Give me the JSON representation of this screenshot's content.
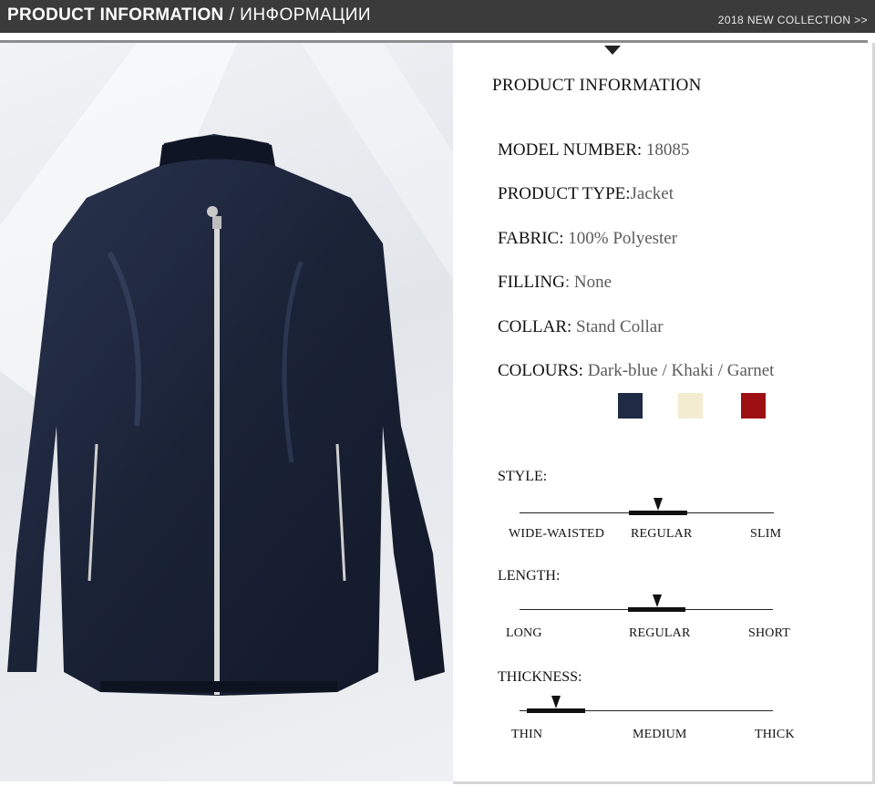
{
  "header": {
    "title": "PRODUCT INFORMATION",
    "separator": "/",
    "subtitle": "ИНФОРМАЦИИ",
    "collection": "2018 NEW COLLECTION >>"
  },
  "info": {
    "title": "PRODUCT INFORMATION",
    "specs": [
      {
        "label": "MODEL NUMBER:",
        "value": " 18085"
      },
      {
        "label": "PRODUCT TYPE:",
        "value": "Jacket"
      },
      {
        "label": "FABRIC:",
        "value": " 100% Polyester"
      },
      {
        "label": "FILLING",
        "value": ": None"
      },
      {
        "label": "COLLAR:",
        "value": " Stand Collar"
      },
      {
        "label": "COLOURS:",
        "value": " Dark-blue / Khaki / Garnet"
      }
    ],
    "swatches": [
      "#1f2a44",
      "#f4ecd0",
      "#9e0f14"
    ],
    "scales": [
      {
        "label": "STYLE:",
        "options": [
          "WIDE-WAISTED",
          "REGULAR",
          "SLIM"
        ],
        "selected": "REGULAR"
      },
      {
        "label": "LENGTH:",
        "options": [
          "LONG",
          "REGULAR",
          "SHORT"
        ],
        "selected": "REGULAR"
      },
      {
        "label": "THICKNESS:",
        "options": [
          "THIN",
          "MEDIUM",
          "THICK"
        ],
        "selected": "THIN"
      }
    ]
  },
  "colors": {
    "header_bg": "#3b3b3b",
    "jacket": "#1c2436"
  },
  "photo": {
    "subject": "dark-blue stand collar jacket"
  }
}
